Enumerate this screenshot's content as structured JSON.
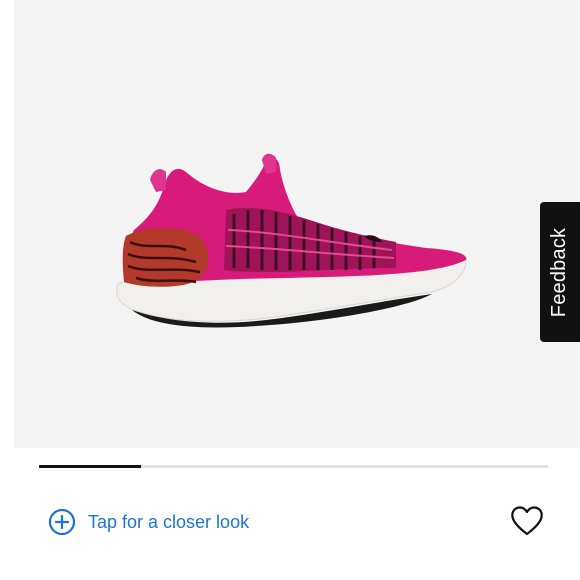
{
  "gallery": {
    "image_alt": "Pink running shoe",
    "progress_fraction": 0.2
  },
  "feedback": {
    "label": "Feedback"
  },
  "actions": {
    "closer_look_label": "Tap for a closer look",
    "closer_look_icon": "plus-circle-icon",
    "favorite_icon": "heart-outline-icon"
  },
  "colors": {
    "accent": "#1e72d6",
    "shoe_upper": "#d81b7a",
    "feedback_bg": "#111111"
  }
}
